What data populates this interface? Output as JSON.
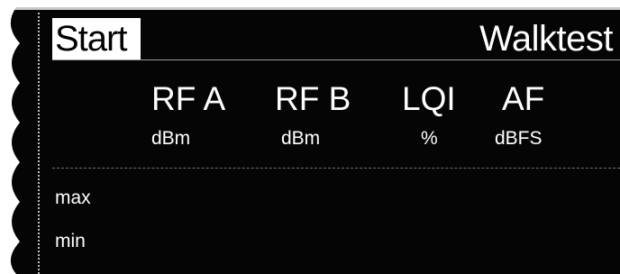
{
  "header": {
    "start_label": "Start",
    "title": "Walktest"
  },
  "columns": [
    {
      "label": "RF A",
      "unit": "dBm"
    },
    {
      "label": "RF B",
      "unit": "dBm"
    },
    {
      "label": "LQI",
      "unit": "%"
    },
    {
      "label": "AF",
      "unit": "dBFS"
    }
  ],
  "rows": {
    "max_label": "max",
    "min_label": "min"
  },
  "colors": {
    "background": "#050505",
    "foreground": "#ffffff",
    "highlight": "#ffffff"
  }
}
